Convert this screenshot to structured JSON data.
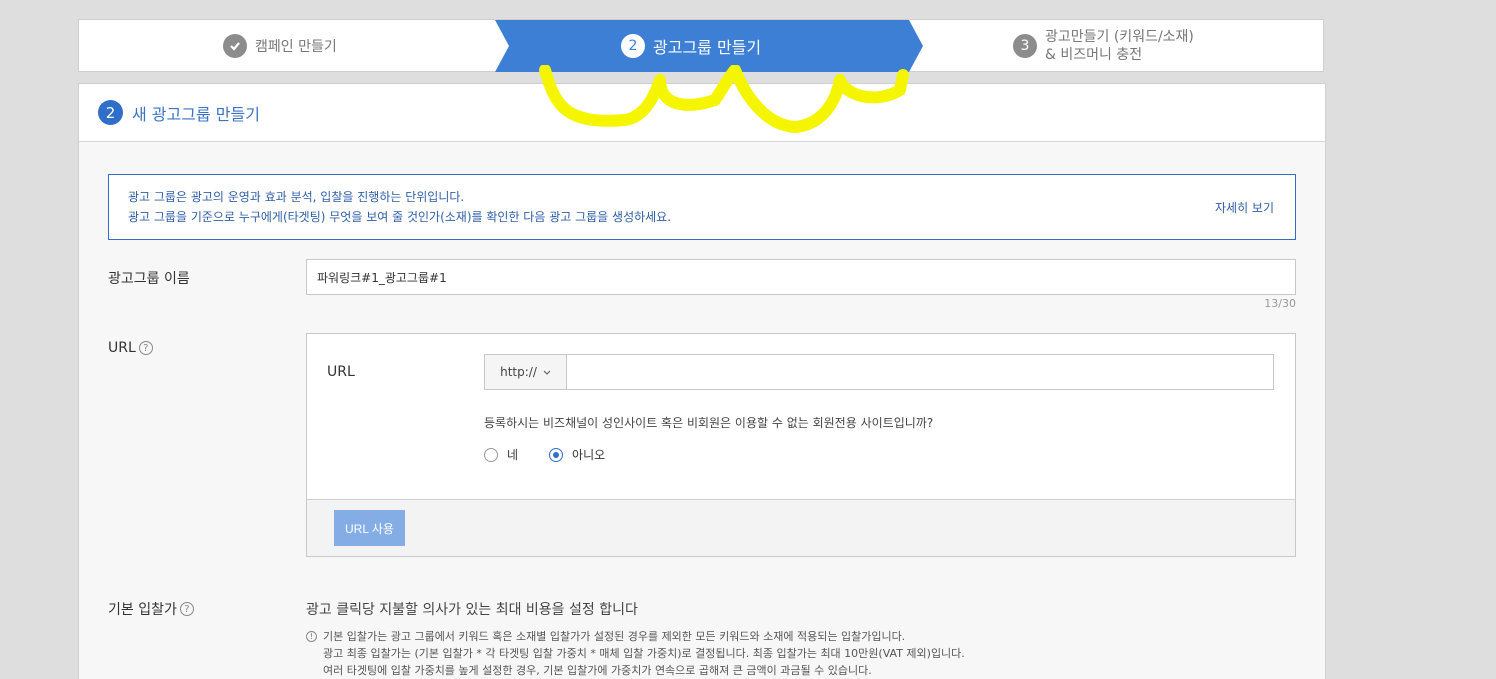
{
  "stepper": {
    "step1": {
      "label": "캠페인 만들기",
      "icon": "check-icon"
    },
    "step2": {
      "number": "2",
      "label": "광고그룹 만들기"
    },
    "step3": {
      "number": "3",
      "line1": "광고만들기 (키워드/소재)",
      "line2": "& 비즈머니 충전"
    }
  },
  "panel": {
    "number": "2",
    "title": "새 광고그룹 만들기",
    "info": {
      "line1": "광고 그룹은 광고의 운영과 효과 분석, 입찰을 진행하는 단위입니다.",
      "line2": "광고 그룹을 기준으로 누구에게(타겟팅) 무엇을 보여 줄 것인가(소재)를 확인한 다음 광고 그룹을 생성하세요.",
      "more": "자세히 보기"
    },
    "name": {
      "label": "광고그룹 이름",
      "value": "파워링크#1_광고그룹#1",
      "counter": "13/30"
    },
    "url": {
      "label": "URL",
      "inner_label": "URL",
      "protocol": "http://",
      "value": "",
      "question": "등록하시는 비즈채널이 성인사이트 혹은 비회원은 이용할 수 없는 회원전용 사이트입니까?",
      "option_yes": "네",
      "option_no": "아니오",
      "selected": "아니오",
      "button": "URL 사용"
    },
    "bid": {
      "label": "기본 입찰가",
      "desc": "광고 클릭당 지불할 의사가 있는 최대 비용을 설정 합니다",
      "note1": "기본 입찰가는 광고 그룹에서 키워드 혹은 소재별 입찰가가 설정된 경우를 제외한 모든 키워드와 소재에 적용되는 입찰가입니다.",
      "note2": "광고 최종 입찰가는 (기본 입찰가 * 각 타겟팅 입찰 가중치 * 매체 입찰 가중치)로 결정됩니다. 최종 입찰가는 최대 10만원(VAT 제외)입니다.",
      "note3": "여러 타겟팅에 입찰 가중치를 높게 설정한 경우, 기본 입찰가에 가중치가 연속으로 곱해져 큰 금액이 과금될 수 있습니다."
    }
  },
  "colors": {
    "accent": "#3c7fd4",
    "annotation": "#f5f500"
  }
}
